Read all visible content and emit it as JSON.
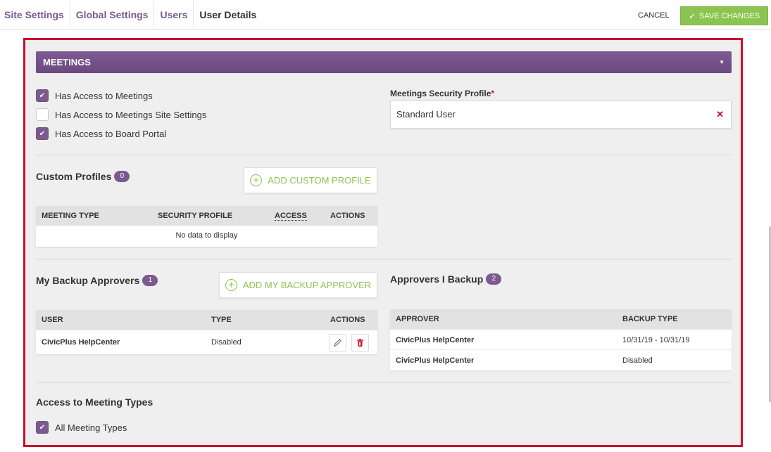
{
  "breadcrumb": [
    "Site Settings",
    "Global Settings",
    "Users",
    "User Details"
  ],
  "toolbar": {
    "cancel_label": "CANCEL",
    "save_label": "SAVE CHANGES"
  },
  "section": {
    "title": "MEETINGS"
  },
  "access_checkboxes": [
    {
      "label": "Has Access to Meetings",
      "checked": true
    },
    {
      "label": "Has Access to Meetings Site Settings",
      "checked": false
    },
    {
      "label": "Has Access to Board Portal",
      "checked": true
    }
  ],
  "security_profile": {
    "label": "Meetings Security Profile",
    "required_mark": "*",
    "value": "Standard User"
  },
  "custom_profiles": {
    "title": "Custom Profiles",
    "count": "0",
    "add_label": "ADD CUSTOM PROFILE",
    "columns": [
      "MEETING TYPE",
      "SECURITY PROFILE",
      "ACCESS",
      "ACTIONS"
    ],
    "empty_text": "No data to display"
  },
  "my_backup_approvers": {
    "title": "My Backup Approvers",
    "count": "1",
    "add_label": "ADD MY BACKUP APPROVER",
    "columns": [
      "USER",
      "TYPE",
      "ACTIONS"
    ],
    "rows": [
      {
        "user": "CivicPlus HelpCenter",
        "type": "Disabled"
      }
    ]
  },
  "approvers_i_backup": {
    "title": "Approvers I Backup",
    "count": "2",
    "columns": [
      "APPROVER",
      "BACKUP TYPE"
    ],
    "rows": [
      {
        "approver": "CivicPlus HelpCenter",
        "backup_type": "10/31/19 - 10/31/19"
      },
      {
        "approver": "CivicPlus HelpCenter",
        "backup_type": "Disabled"
      }
    ]
  },
  "meeting_types": {
    "title": "Access to Meeting Types",
    "all_label": "All Meeting Types",
    "all_checked": true
  },
  "colors": {
    "accent_purple": "#7a5a8f",
    "save_green": "#8cc450",
    "highlight_red": "#c8102e"
  }
}
